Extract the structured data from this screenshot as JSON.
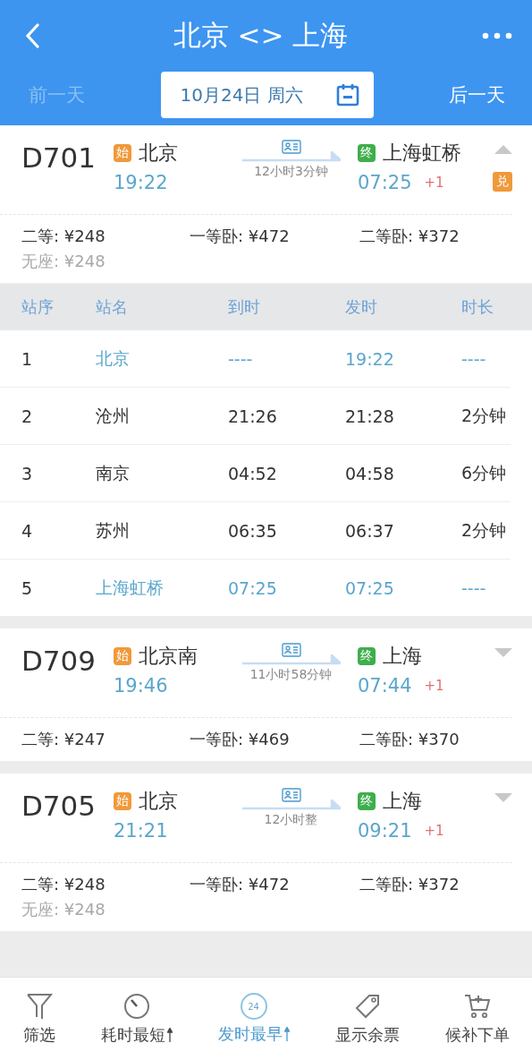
{
  "header": {
    "title": "北京 <> 上海",
    "prev_day": {
      "label": "前一天",
      "disabled": true
    },
    "date": "10月24日 周六",
    "next_day": {
      "label": "后一天",
      "disabled": false
    }
  },
  "trains": [
    {
      "number": "D701",
      "from": {
        "badge": "始",
        "name": "北京",
        "time": "19:22"
      },
      "duration": "12小时3分钟",
      "to": {
        "badge": "终",
        "name": "上海虹桥",
        "time": "07:25",
        "day_offset": "+1"
      },
      "expanded": true,
      "exchange_badge": "兑",
      "prices": [
        {
          "label": "二等: ¥248",
          "dimmed": false
        },
        {
          "label": "一等卧: ¥472",
          "dimmed": false
        },
        {
          "label": "二等卧: ¥372",
          "dimmed": false
        },
        {
          "label": "无座: ¥248",
          "dimmed": true
        }
      ],
      "stops": {
        "columns": [
          "站序",
          "站名",
          "到时",
          "发时",
          "时长"
        ],
        "rows": [
          {
            "cells": [
              "1",
              "北京",
              "----",
              "19:22",
              "----"
            ],
            "highlighted": true
          },
          {
            "cells": [
              "2",
              "沧州",
              "21:26",
              "21:28",
              "2分钟"
            ],
            "highlighted": false
          },
          {
            "cells": [
              "3",
              "南京",
              "04:52",
              "04:58",
              "6分钟"
            ],
            "highlighted": false
          },
          {
            "cells": [
              "4",
              "苏州",
              "06:35",
              "06:37",
              "2分钟"
            ],
            "highlighted": false
          },
          {
            "cells": [
              "5",
              "上海虹桥",
              "07:25",
              "07:25",
              "----"
            ],
            "highlighted": true
          }
        ]
      }
    },
    {
      "number": "D709",
      "from": {
        "badge": "始",
        "name": "北京南",
        "time": "19:46"
      },
      "duration": "11小时58分钟",
      "to": {
        "badge": "终",
        "name": "上海",
        "time": "07:44",
        "day_offset": "+1"
      },
      "expanded": false,
      "prices": [
        {
          "label": "二等: ¥247",
          "dimmed": false
        },
        {
          "label": "一等卧: ¥469",
          "dimmed": false
        },
        {
          "label": "二等卧: ¥370",
          "dimmed": false
        }
      ]
    },
    {
      "number": "D705",
      "from": {
        "badge": "始",
        "name": "北京",
        "time": "21:21"
      },
      "duration": "12小时整",
      "to": {
        "badge": "终",
        "name": "上海",
        "time": "09:21",
        "day_offset": "+1"
      },
      "expanded": false,
      "prices": [
        {
          "label": "二等: ¥248",
          "dimmed": false
        },
        {
          "label": "一等卧: ¥472",
          "dimmed": false
        },
        {
          "label": "二等卧: ¥372",
          "dimmed": false
        },
        {
          "label": "无座: ¥248",
          "dimmed": true
        }
      ]
    }
  ],
  "bottom_bar": [
    {
      "kind": "filter",
      "label": "筛选",
      "selected": false,
      "sort_arrow": false
    },
    {
      "kind": "timer",
      "label": "耗时最短",
      "selected": false,
      "sort_arrow": true
    },
    {
      "kind": "clock24",
      "label": "发时最早",
      "icon_text": "24",
      "selected": true,
      "sort_arrow": true
    },
    {
      "kind": "tag",
      "label": "显示余票",
      "selected": false,
      "sort_arrow": false
    },
    {
      "kind": "cart",
      "label": "候补下单",
      "selected": false,
      "sort_arrow": false
    }
  ]
}
